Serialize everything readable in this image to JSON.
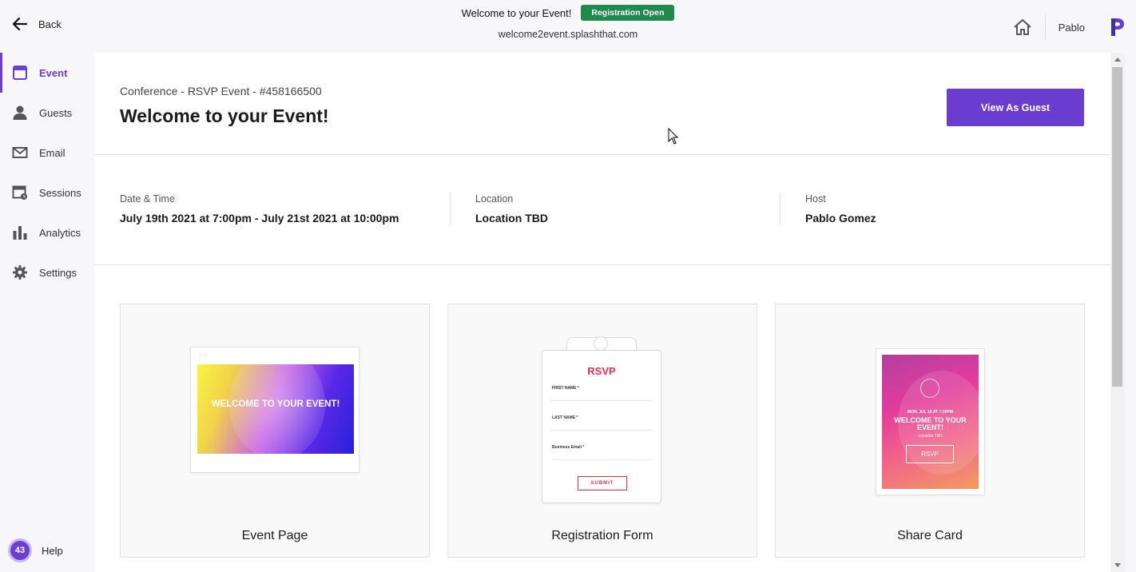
{
  "topbar": {
    "back_label": "Back",
    "event_title": "Welcome to your Event!",
    "status_badge": "Registration Open",
    "url": "welcome2event.splashthat.com",
    "user_name": "Pablo"
  },
  "sidebar": {
    "items": [
      {
        "label": "Event",
        "icon": "calendar-icon",
        "active": true
      },
      {
        "label": "Guests",
        "icon": "person-icon"
      },
      {
        "label": "Email",
        "icon": "envelope-icon"
      },
      {
        "label": "Sessions",
        "icon": "sessions-icon"
      },
      {
        "label": "Analytics",
        "icon": "bar-chart-icon"
      },
      {
        "label": "Settings",
        "icon": "gear-icon"
      }
    ],
    "help_count": "43",
    "help_label": "Help"
  },
  "header": {
    "breadcrumb": "Conference - RSVP Event - #458166500",
    "title": "Welcome to your Event!",
    "view_as_guest": "View As Guest"
  },
  "info": {
    "date_label": "Date & Time",
    "date_value": "July 19th 2021 at 7:00pm - July 21st 2021 at 10:00pm",
    "location_label": "Location",
    "location_value": "Location TBD",
    "host_label": "Host",
    "host_value": "Pablo Gomez"
  },
  "cards": {
    "event_page": {
      "label": "Event Page",
      "hero_text": "WELCOME TO YOUR EVENT!"
    },
    "registration_form": {
      "label": "Registration Form",
      "title": "RSVP",
      "fields": [
        "FIRST NAME *",
        "LAST NAME *",
        "Business Email *"
      ],
      "submit": "SUBMIT"
    },
    "share_card": {
      "label": "Share Card",
      "date": "MON, JUL 19 AT 7:00PM",
      "welcome": "WELCOME TO YOUR EVENT!",
      "location": "Location TBD",
      "rsvp": "RSVP"
    }
  },
  "colors": {
    "accent": "#6a3ccf",
    "success": "#1f8a4c",
    "rsvp_red": "#e2334b"
  }
}
